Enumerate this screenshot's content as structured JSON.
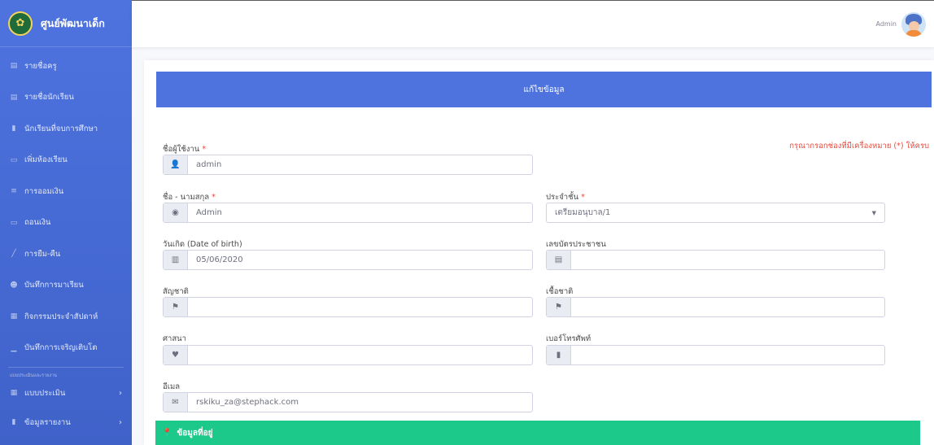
{
  "brand": {
    "name": "ศูนย์พัฒนาเด็ก",
    "logo_icon": "school-emblem-icon"
  },
  "sidebar": {
    "items": [
      {
        "label": "รายชื่อครู",
        "icon": "list-icon"
      },
      {
        "label": "รายชื่อนักเรียน",
        "icon": "list-icon"
      },
      {
        "label": "นักเรียนที่จบการศึกษา",
        "icon": "file-icon"
      },
      {
        "label": "เพิ่มห้องเรียน",
        "icon": "chat-icon"
      },
      {
        "label": "การออมเงิน",
        "icon": "coins-icon"
      },
      {
        "label": "ถอนเงิน",
        "icon": "money-icon"
      },
      {
        "label": "การยืม-คืน",
        "icon": "pen-icon"
      },
      {
        "label": "บันทึกการมาเรียน",
        "icon": "user-check-icon"
      },
      {
        "label": "กิจกรรมประจำสัปดาห์",
        "icon": "table-icon"
      },
      {
        "label": "บันทึกการเจริญเติบโต",
        "icon": "chart-icon"
      }
    ],
    "heading": "แบบประเมินและรายงาน",
    "collapsibles": [
      {
        "label": "แบบประเมิน",
        "icon": "table-icon"
      },
      {
        "label": "ข้อมูลรายงาน",
        "icon": "file-icon"
      }
    ]
  },
  "topbar": {
    "username": "Admin"
  },
  "form": {
    "header": "แก้ไขข้อมูล",
    "required_note": "กรุณากรอกช่องที่มีเครื่องหมาย (*) ให้ครบ",
    "required_mark": "*",
    "username": {
      "label": "ชื่อผู้ใช้งาน",
      "value": "admin",
      "icon": "user-icon"
    },
    "fullname": {
      "label": "ชื่อ - นามสกุล",
      "value": "Admin",
      "icon": "user-circle-icon"
    },
    "class": {
      "label": "ประจำชั้น",
      "value": "เตรียมอนุบาล/1"
    },
    "birthdate": {
      "label": "วันเกิด (Date of birth)",
      "value": "05/06/2020",
      "icon": "cake-icon"
    },
    "id_card": {
      "label": "เลขบัตรประชาชน",
      "value": "",
      "icon": "id-card-icon"
    },
    "nationality": {
      "label": "สัญชาติ",
      "value": "",
      "icon": "flag-icon"
    },
    "ethnicity": {
      "label": "เชื้อชาติ",
      "value": "",
      "icon": "flag-icon"
    },
    "religion": {
      "label": "ศาสนา",
      "value": "",
      "icon": "heart-icon"
    },
    "phone": {
      "label": "เบอร์โทรศัพท์",
      "value": "",
      "icon": "mobile-icon"
    },
    "email": {
      "label": "อีเมล",
      "value": "rskiku_za@stephack.com",
      "icon": "envelope-icon"
    }
  },
  "address_section": {
    "title": "ข้อมูลที่อยู่",
    "icon": "map-pin-icon"
  },
  "colors": {
    "primary": "#4e73df",
    "success": "#1cc88a",
    "danger": "#e74a3b"
  }
}
